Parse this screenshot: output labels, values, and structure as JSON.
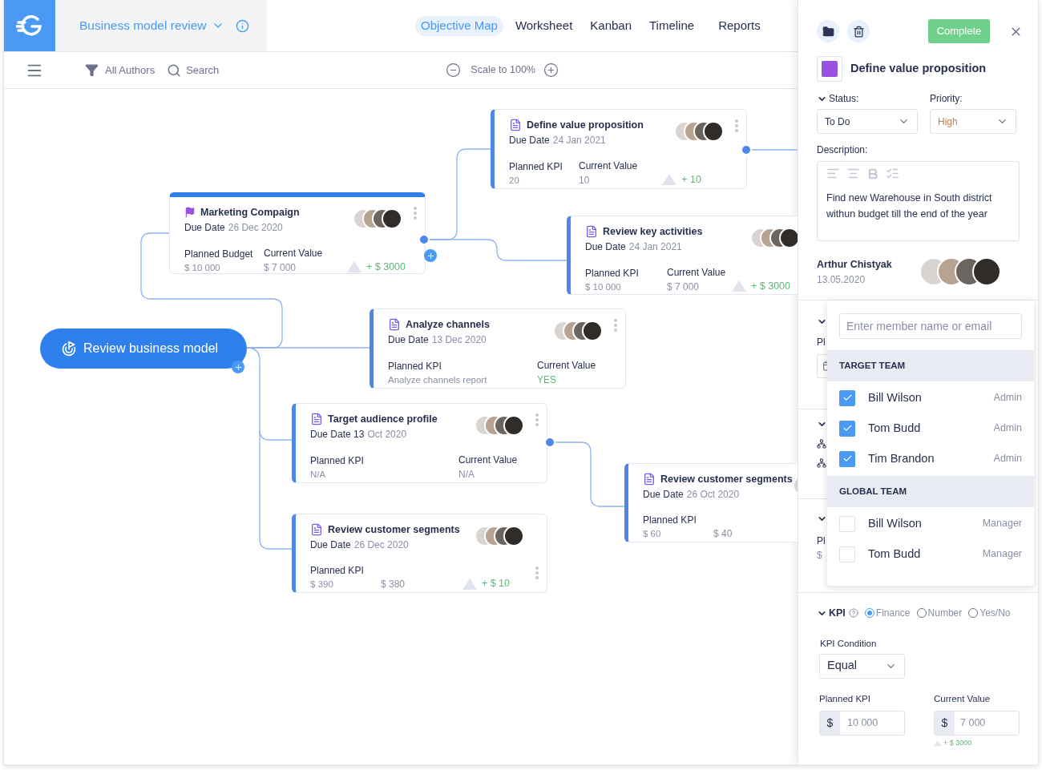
{
  "header": {
    "title": "Business model review",
    "tabs": [
      {
        "label": "Objective Map",
        "selected": true
      },
      {
        "label": "Worksheet",
        "selected": false
      },
      {
        "label": "Kanban",
        "selected": false
      },
      {
        "label": "Timeline",
        "selected": false
      },
      {
        "label": "Reports",
        "selected": false
      }
    ]
  },
  "toolbar": {
    "filter": "All Authors",
    "search": "Search",
    "scale": "Scale to 100%"
  },
  "map": {
    "root": {
      "label": "Review business model"
    },
    "cards": [
      {
        "kind": "task",
        "title": "Define value proposition",
        "due_label": "Due Date",
        "due_date": "24 Jan 2021",
        "planned_label": "Planned KPI",
        "planned_value": "20",
        "current_label": "Current Value",
        "current_value": "10",
        "current_positive": false,
        "delta": "+ 10"
      },
      {
        "kind": "goal",
        "title": "Marketing Compaign",
        "due_label": "Due Date",
        "due_date": "26 Dec 2020",
        "planned_label": "Planned Budget",
        "planned_value": "$ 10 000",
        "current_label": "Current Value",
        "current_value": "$ 7 000",
        "current_positive": false,
        "delta": "+ $ 3000"
      },
      {
        "kind": "task",
        "title": "Review key activities",
        "due_label": "Due Date",
        "due_date": "24 Jan 2021",
        "planned_label": "Planned KPI",
        "planned_value": "$ 10 000",
        "current_label": "Current Value",
        "current_value": "$ 7 000",
        "current_positive": false,
        "delta": "+ $ 3000"
      },
      {
        "kind": "task",
        "title": "Analyze channels",
        "due_label": "Due Date",
        "due_date": "13 Dec 2020",
        "planned_label": "Planned KPI",
        "planned_value": "Analyze channels report",
        "current_label": "Current Value",
        "current_value": "YES",
        "current_positive": true
      },
      {
        "kind": "task",
        "title": "Target audience profile",
        "due_label": "Due Date 13",
        "due_date": "Oct 2020",
        "planned_label": "Planned KPI",
        "planned_value": "N/A",
        "current_label": "Current Value",
        "current_value": "N/A",
        "current_positive": false
      },
      {
        "kind": "task",
        "title": "Review customer segments",
        "due_label": "Due Date",
        "due_date": "26 Oct 2020",
        "planned_label": "Planned KPI",
        "planned_value": "$ 60",
        "current_value": "$ 40",
        "current_positive": false
      },
      {
        "kind": "task",
        "title": "Review customer segments",
        "due_label": "Due Date",
        "due_date": "26 Dec 2020",
        "planned_label": "Planned KPI",
        "planned_value": "$ 390",
        "current_value": "$ 380",
        "current_positive": false,
        "delta": "+ $ 10"
      }
    ]
  },
  "panel": {
    "complete": "Complete",
    "color": "#9b51e0",
    "title": "Define value proposition",
    "status": {
      "label": "Status:",
      "value": "To Do"
    },
    "priority": {
      "label": "Priority:",
      "value": "High"
    },
    "description": {
      "label": "Description:",
      "text": "Find new Warehouse in South district withun budget till the end of the year"
    },
    "author": {
      "name": "Arthur Chistyak",
      "date": "13.05.2020"
    },
    "hidden_labels": [
      "Pl",
      "Pl",
      "$"
    ],
    "members": {
      "placeholder": "Enter member name or email",
      "groups": [
        {
          "title": "TARGET TEAM",
          "members": [
            {
              "name": "Bill Wilson",
              "role": "Admin",
              "checked": true
            },
            {
              "name": "Tom Budd",
              "role": "Admin",
              "checked": true
            },
            {
              "name": "Tim Brandon",
              "role": "Admin",
              "checked": true
            }
          ]
        },
        {
          "title": "GLOBAL TEAM",
          "members": [
            {
              "name": "Bill Wilson",
              "role": "Manager",
              "checked": false
            },
            {
              "name": "Tom Budd",
              "role": "Manager",
              "checked": false
            }
          ]
        }
      ]
    },
    "kpi": {
      "label": "KPI",
      "types": [
        {
          "label": "Finance",
          "selected": true
        },
        {
          "label": "Number",
          "selected": false
        },
        {
          "label": "Yes/No",
          "selected": false
        }
      ],
      "condition_label": "KPI Condition",
      "condition": "Equal",
      "planned_label": "Planned KPI",
      "currency": "$",
      "planned_value": "10 000",
      "current_label": "Current Value",
      "current_currency": "$",
      "current_value": "7 000",
      "delta": "+ $ 3000"
    }
  }
}
